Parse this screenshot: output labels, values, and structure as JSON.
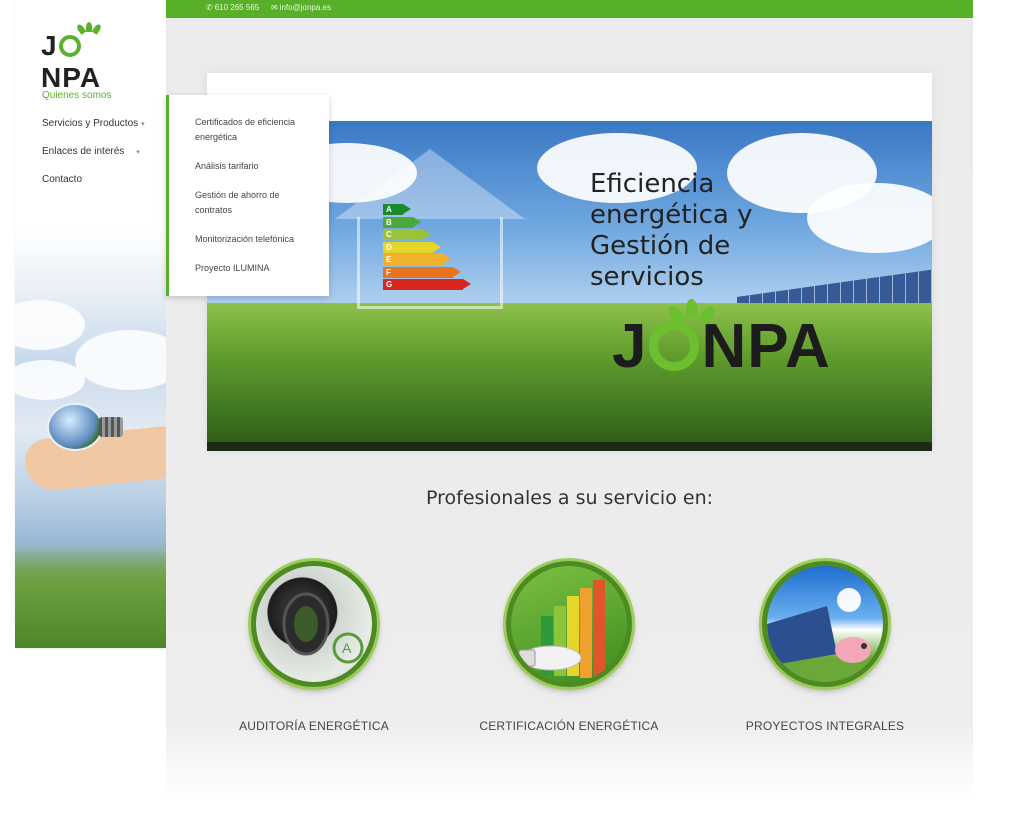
{
  "topbar": {
    "phone": "610 265 565",
    "email": "info@jonpa.es",
    "phone_icon": "phone-icon",
    "email_icon": "envelope-icon"
  },
  "brand": {
    "logo_text": "JONPA",
    "accent_color": "#58b029"
  },
  "nav": {
    "items": [
      {
        "label": "Quienes somos",
        "active": true
      },
      {
        "label": "Servicios y Productos",
        "has_submenu": true,
        "open": true
      },
      {
        "label": "Enlaces de interés",
        "has_submenu": true
      },
      {
        "label": "Contacto"
      }
    ]
  },
  "dropdown": {
    "items": [
      {
        "label": "Certificados de eficiencia energética"
      },
      {
        "label": "Análisis tarifario"
      },
      {
        "label": "Gestión de ahorro de contratos"
      },
      {
        "label": "Monitorización telefónica"
      },
      {
        "label": "Proyecto ILUMINA"
      }
    ]
  },
  "hero": {
    "title": "Eficiencia energética y Gestión de servicios",
    "logo_text": "JONPA",
    "energy_grades": [
      {
        "letter": "A",
        "color": "#1a8a2e"
      },
      {
        "letter": "B",
        "color": "#4ca83a"
      },
      {
        "letter": "C",
        "color": "#9cc23a"
      },
      {
        "letter": "D",
        "color": "#e6d62a"
      },
      {
        "letter": "E",
        "color": "#f0b22c"
      },
      {
        "letter": "F",
        "color": "#e8741f"
      },
      {
        "letter": "G",
        "color": "#d8261f"
      }
    ]
  },
  "services": {
    "heading": "Profesionales a su servicio en:",
    "items": [
      {
        "label": "AUDITORÍA ENERGÉTICA",
        "icon": "energy-meter-icon"
      },
      {
        "label": "CERTIFICACIÓN ENERGÉTICA",
        "icon": "energy-rating-bulb-icon"
      },
      {
        "label": "PROYECTOS INTEGRALES",
        "icon": "solar-panel-piggybank-icon"
      }
    ]
  }
}
